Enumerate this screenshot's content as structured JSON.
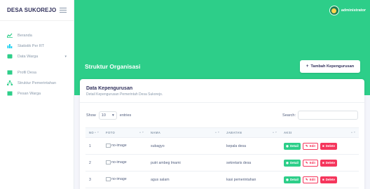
{
  "brand": {
    "title": "DESA SUKOREJO"
  },
  "sidebar": {
    "items": [
      {
        "label": "Beranda",
        "icon": "chart-icon",
        "color": "#2dce89"
      },
      {
        "label": "Statistik Per RT",
        "icon": "bar-chart-icon",
        "color": "#11cdef"
      },
      {
        "label": "Data Warga",
        "icon": "users-icon",
        "color": "#2dce89",
        "caret": "▾"
      },
      {
        "label": "Profil Desa",
        "icon": "building-icon",
        "color": "#2dce89"
      },
      {
        "label": "Struktur Pemerintahan",
        "icon": "sitemap-icon",
        "color": "#2dce89"
      },
      {
        "label": "Pesan Warga",
        "icon": "message-icon",
        "color": "#2dce89"
      }
    ]
  },
  "header": {
    "user_name": "administrator"
  },
  "hero": {
    "title": "Struktur Organisasi",
    "add_button": "Tambah Kepengurusan"
  },
  "card": {
    "title": "Data Kepengurusan",
    "subtitle": "Detail Kepengurusan Pemerintah Desa Sukorejo.",
    "show_label": "Show",
    "entries_value": "10",
    "entries_label": "entries",
    "search_label": "Search:",
    "search_value": ""
  },
  "table": {
    "headers": [
      "NO",
      "FOTO",
      "NAMA",
      "JABATAN",
      "AKSI"
    ],
    "rows": [
      {
        "no": "1",
        "foto": "no-image",
        "nama": "subagyo",
        "jabatan": "kepala desa"
      },
      {
        "no": "2",
        "foto": "no-image",
        "nama": "putri ambeg lmami",
        "jabatan": "sekretaris desa"
      },
      {
        "no": "3",
        "foto": "no-image",
        "nama": "agus salam",
        "jabatan": "kasi pemerintahan"
      }
    ],
    "actions": {
      "detail": "Detail",
      "edit": "Edit",
      "delete": "Delete"
    }
  },
  "colors": {
    "accent": "#2dce89",
    "danger": "#f5365c",
    "text": "#525f7f"
  }
}
